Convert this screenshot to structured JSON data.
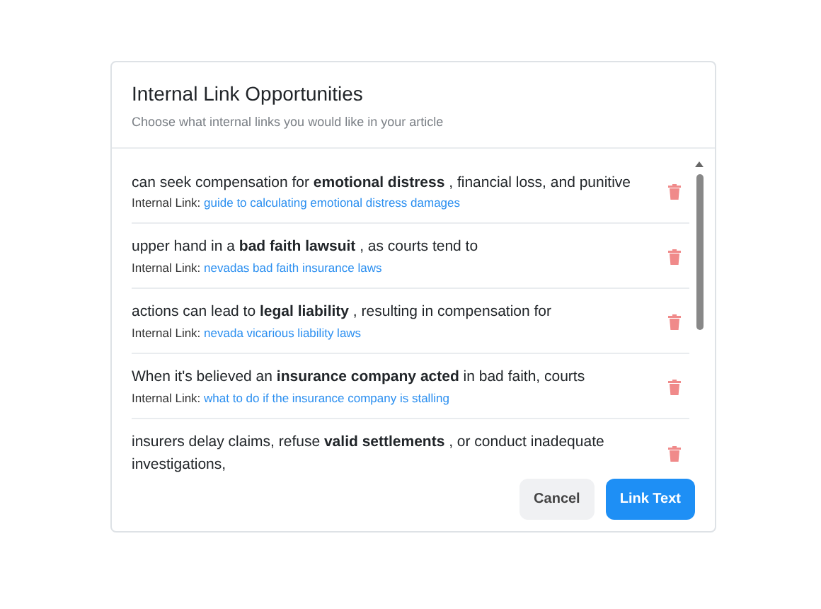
{
  "modal": {
    "title": "Internal Link Opportunities",
    "subtitle": "Choose what internal links you would like in your article"
  },
  "items": [
    {
      "text": "can seek compensation for **emotional distress** , financial loss, and punitive",
      "link_label": "Internal Link:",
      "link": "guide to calculating emotional distress damages"
    },
    {
      "text": "upper hand in a **bad faith lawsuit** , as courts tend to",
      "link_label": "Internal Link:",
      "link": "nevadas bad faith insurance laws"
    },
    {
      "text": "actions can lead to **legal liability** , resulting in compensation for",
      "link_label": "Internal Link:",
      "link": "nevada vicarious liability laws"
    },
    {
      "text": "When it's believed an **insurance company acted** in bad faith, courts",
      "link_label": "Internal Link:",
      "link": "what to do if the insurance company is stalling"
    },
    {
      "text": "insurers delay claims, refuse **valid settlements** , or conduct inadequate investigations,"
    }
  ],
  "buttons": [
    {
      "label": "Cancel",
      "kind": "secondary"
    },
    {
      "label": "Link Text",
      "kind": "primary"
    }
  ]
}
